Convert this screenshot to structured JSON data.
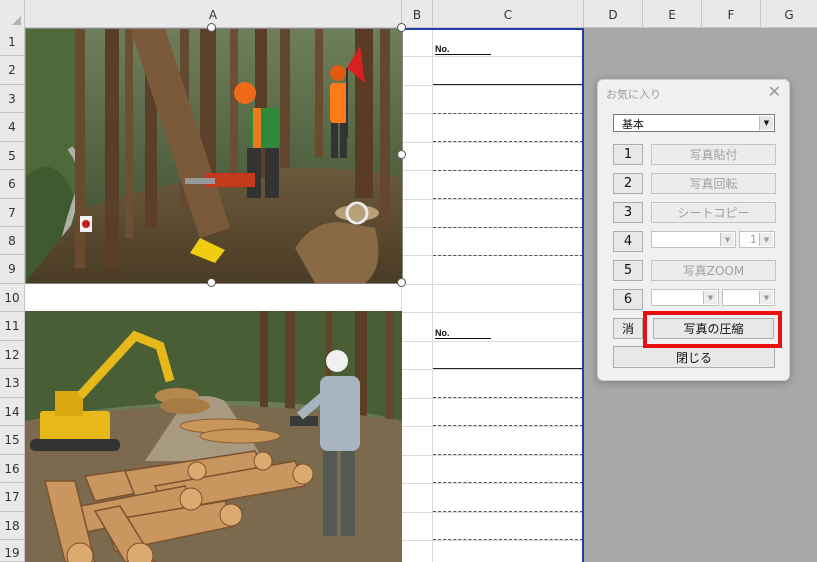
{
  "columns": [
    "A",
    "B",
    "C",
    "D",
    "E",
    "F",
    "G"
  ],
  "rows": [
    "1",
    "2",
    "3",
    "4",
    "5",
    "6",
    "7",
    "8",
    "9",
    "10",
    "11",
    "12",
    "13",
    "14",
    "15",
    "16",
    "17",
    "18",
    "19"
  ],
  "sheet": {
    "no_label_1": "No.",
    "no_label_2": "No."
  },
  "dialog": {
    "title": "お気に入り",
    "close": "✕",
    "preset": "基本",
    "buttons": [
      {
        "num": "1",
        "label": "写真貼付"
      },
      {
        "num": "2",
        "label": "写真回転"
      },
      {
        "num": "3",
        "label": "シートコピー"
      },
      {
        "num": "4",
        "label": ""
      },
      {
        "num": "5",
        "label": "写真ZOOM"
      },
      {
        "num": "6",
        "label": ""
      }
    ],
    "row4_small_value": "1",
    "erase": "消",
    "compress": "写真の圧縮",
    "close_btn": "閉じる"
  }
}
